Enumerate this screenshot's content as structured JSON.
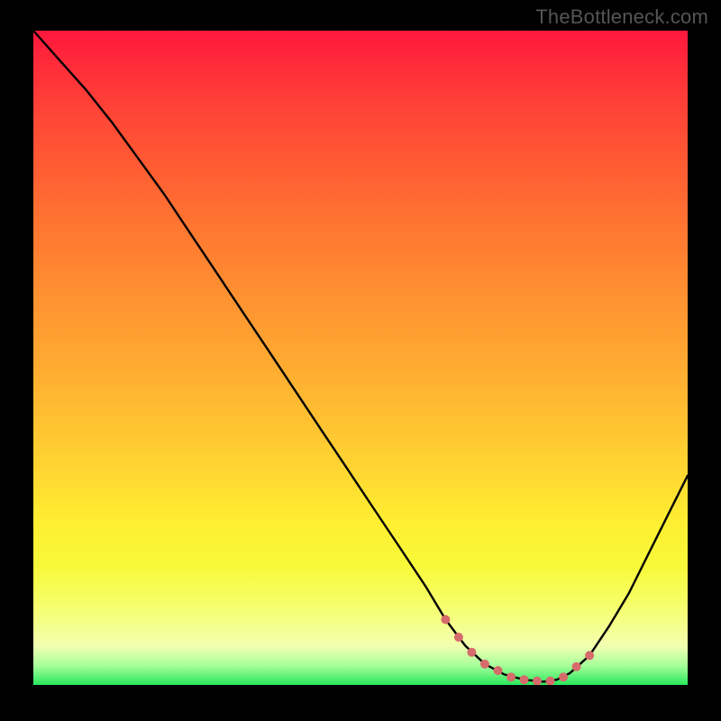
{
  "watermark": "TheBottleneck.com",
  "colors": {
    "marker": "#d66b6b",
    "curve": "#000000"
  },
  "chart_data": {
    "type": "line",
    "title": "",
    "xlabel": "",
    "ylabel": "",
    "xlim": [
      0,
      100
    ],
    "ylim": [
      0,
      100
    ],
    "grid": false,
    "series": [
      {
        "name": "bottleneck-curve",
        "x": [
          0,
          4,
          8,
          12,
          16,
          20,
          24,
          28,
          32,
          36,
          40,
          44,
          48,
          52,
          56,
          60,
          63,
          66,
          69,
          72,
          75,
          78,
          80,
          82,
          85,
          88,
          91,
          94,
          97,
          100
        ],
        "y": [
          100,
          95.5,
          91,
          86,
          80.5,
          75,
          69,
          63,
          57,
          51,
          45,
          39,
          33,
          27,
          21,
          15,
          10,
          6,
          3.2,
          1.6,
          0.8,
          0.5,
          0.8,
          1.8,
          4.5,
          9,
          14,
          20,
          26,
          32
        ]
      }
    ],
    "markers": {
      "name": "optimal-range",
      "x": [
        63,
        65,
        67,
        69,
        71,
        73,
        75,
        77,
        79,
        81,
        83,
        85
      ],
      "y": [
        10,
        7.3,
        5,
        3.2,
        2.2,
        1.2,
        0.8,
        0.6,
        0.6,
        1.2,
        2.8,
        4.5
      ],
      "style": "dot",
      "color": "#d66b6b",
      "radius_px": 5
    }
  }
}
